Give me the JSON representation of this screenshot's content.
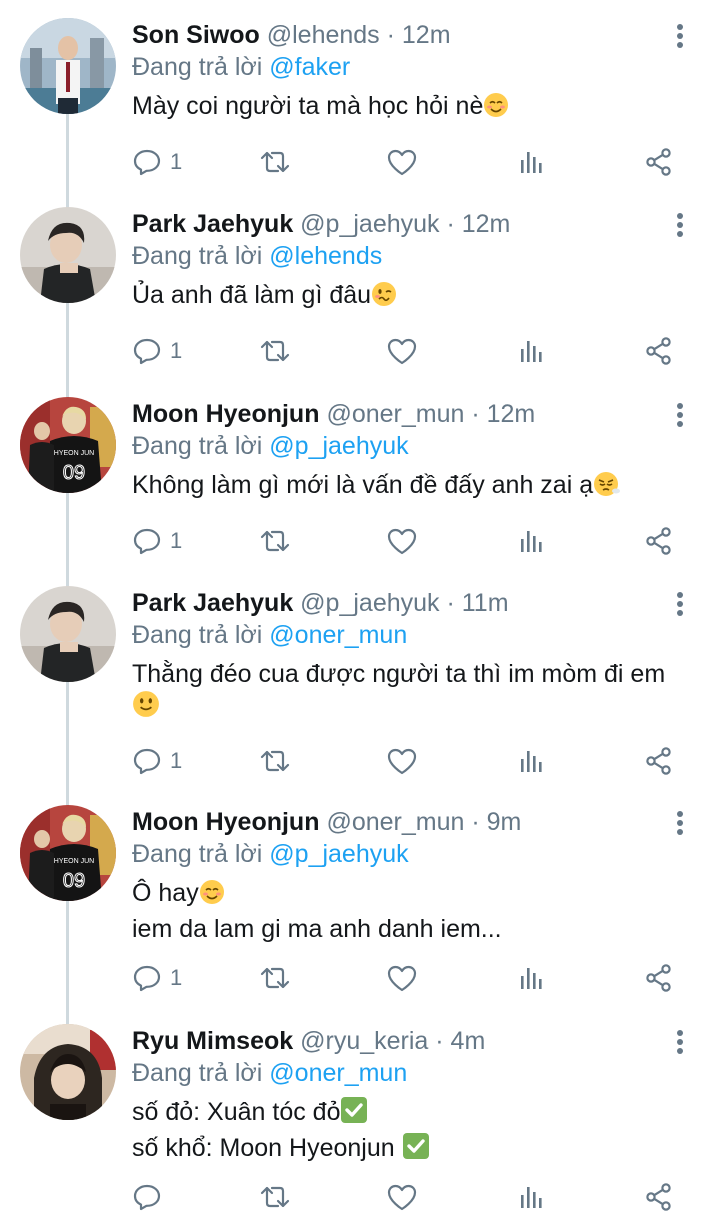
{
  "labels": {
    "replying_prefix": "Đang trả lời "
  },
  "colors": {
    "link": "#1da1f2",
    "meta": "#657786",
    "thread_line": "#cfd9de",
    "check_green": "#77b255",
    "emoji_yellow": "#ffcc4d"
  },
  "tweets": [
    {
      "name": "Son Siwoo",
      "handle": "@lehends",
      "time": " · 12m",
      "reply_to": "@faker",
      "lines": [
        "Mày coi người ta mà học hỏi nè"
      ],
      "emoji": [
        "smiling-blush-emoji"
      ],
      "reply_count": "1"
    },
    {
      "name": "Park Jaehyuk",
      "handle": "@p_jaehyuk",
      "time": " · 12m",
      "reply_to": "@lehends",
      "lines": [
        "Ủa anh đã làm gì đâu"
      ],
      "emoji": [
        "woozy-face-emoji"
      ],
      "reply_count": "1"
    },
    {
      "name": "Moon Hyeonjun",
      "handle": "@oner_mun",
      "time": " · 12m",
      "reply_to": "@p_jaehyuk",
      "lines": [
        "Không làm gì mới là vấn đề đấy anh zai ạ"
      ],
      "emoji": [
        "tired-sigh-emoji"
      ],
      "reply_count": "1"
    },
    {
      "name": "Park Jaehyuk",
      "handle": "@p_jaehyuk",
      "time": " · 11m",
      "reply_to": "@oner_mun",
      "lines": [
        "Thằng đéo cua được người ta thì im mòm đi em"
      ],
      "emoji": [
        "slight-smile-emoji"
      ],
      "reply_count": "1"
    },
    {
      "name": "Moon Hyeonjun",
      "handle": "@oner_mun",
      "time": " · 9m",
      "reply_to": "@p_jaehyuk",
      "lines": [
        "Ô hay",
        "iem da lam gi ma anh danh iem..."
      ],
      "emoji": [
        "smiling-blush-emoji"
      ],
      "reply_count": "1"
    },
    {
      "name": "Ryu Mimseok",
      "handle": "@ryu_keria",
      "time": " · 4m",
      "reply_to": "@oner_mun",
      "lines": [
        "số đỏ: Xuân tóc đỏ",
        "số khổ: Moon Hyeonjun "
      ],
      "emoji": [
        "check-mark-emoji",
        "check-mark-emoji"
      ],
      "reply_count": ""
    }
  ]
}
